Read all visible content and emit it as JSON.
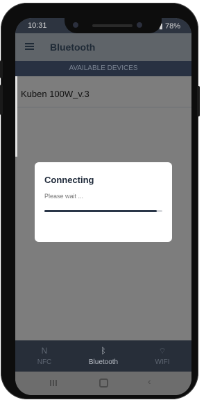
{
  "status_bar": {
    "time": "10:31",
    "battery": "78%"
  },
  "app_bar": {
    "title": "Bluetooth",
    "menu_icon": "hamburger-icon"
  },
  "section": {
    "header": "AVAILABLE DEVICES"
  },
  "devices": [
    {
      "name": "Kuben 100W_v.3"
    }
  ],
  "dialog": {
    "title": "Connecting",
    "message": "Please wait ...",
    "progress_fraction": 0.95
  },
  "bottom_tabs": [
    {
      "label": "NFC",
      "icon": "nfc-icon",
      "active": false
    },
    {
      "label": "Bluetooth",
      "icon": "bluetooth-icon",
      "active": true
    },
    {
      "label": "WIFI",
      "icon": "wifi-icon",
      "active": false
    }
  ],
  "nav_bar": {
    "icons": [
      "recent-apps-icon",
      "home-icon",
      "back-icon"
    ]
  },
  "colors": {
    "status_bar": "#2d3440",
    "section_header": "#283142",
    "dialog_accent": "#2a3648",
    "tab_bar": "#272e39"
  }
}
